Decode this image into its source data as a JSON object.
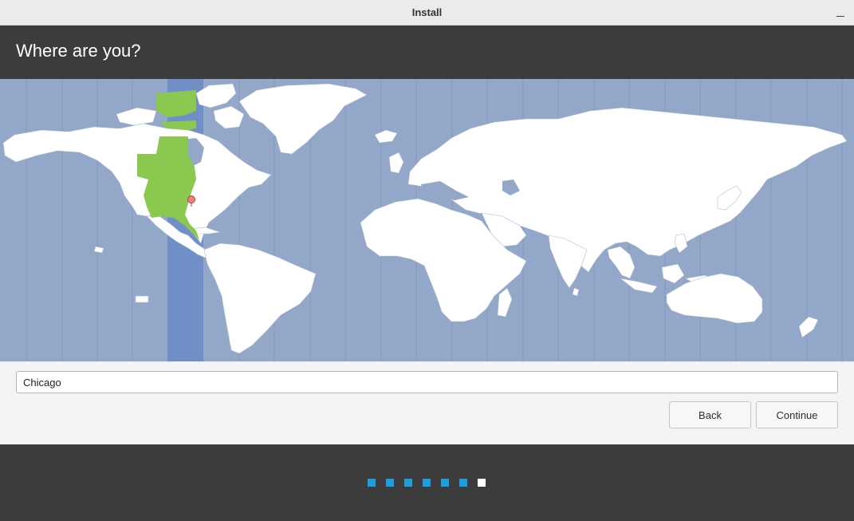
{
  "window": {
    "title": "Install"
  },
  "header": {
    "title": "Where are you?"
  },
  "map": {
    "selected_city_marker": "location-pin-icon",
    "colors": {
      "ocean": "#93a8c9",
      "land": "#ffffff",
      "selected_timezone_band": "#6f8fc6",
      "selected_timezone_land": "#8ac84f",
      "marker": "#f08080"
    }
  },
  "location": {
    "value": "Chicago"
  },
  "buttons": {
    "back": "Back",
    "continue": "Continue"
  },
  "progress": {
    "total_steps": 7,
    "current_step": 7,
    "colors": {
      "done": "#1f9ede",
      "current": "#ffffff"
    }
  }
}
